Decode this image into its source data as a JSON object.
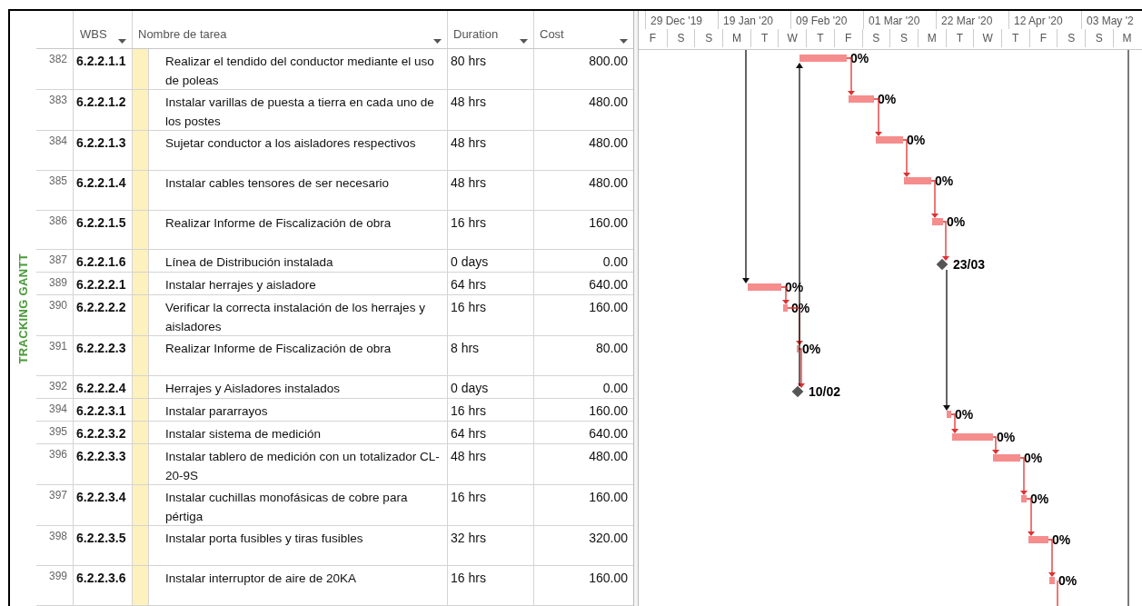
{
  "view_label": "TRACKING GANTT",
  "columns": [
    {
      "label": "WBS"
    },
    {
      "label": "Nombre de tarea"
    },
    {
      "label": "Duration"
    },
    {
      "label": "Cost"
    }
  ],
  "timescale": {
    "major": [
      "29 Dec '19",
      "19 Jan '20",
      "09 Feb '20",
      "01 Mar '20",
      "22 Mar '20",
      "12 Apr '20",
      "03 May '2"
    ],
    "minor": [
      "F",
      "S",
      "S",
      "M",
      "T",
      "W",
      "T",
      "F",
      "S",
      "S",
      "M",
      "T",
      "W",
      "T",
      "F",
      "S",
      "S",
      "M"
    ]
  },
  "rows": [
    {
      "id": "382",
      "wbs": "6.2.2.1.1",
      "name": "Realizar el tendido del conductor mediante el uso de poleas",
      "duration": "80 hrs",
      "cost": "800.00",
      "bar": {
        "kind": "task",
        "label": "0%"
      }
    },
    {
      "id": "383",
      "wbs": "6.2.2.1.2",
      "name": "Instalar varillas de puesta a tierra en cada uno de los postes",
      "duration": "48 hrs",
      "cost": "480.00",
      "bar": {
        "kind": "task",
        "label": "0%"
      }
    },
    {
      "id": "384",
      "wbs": "6.2.2.1.3",
      "name": "Sujetar conductor a los aisladores respectivos",
      "duration": "48 hrs",
      "cost": "480.00",
      "bar": {
        "kind": "task",
        "label": "0%"
      }
    },
    {
      "id": "385",
      "wbs": "6.2.2.1.4",
      "name": "Instalar cables tensores de ser necesario",
      "duration": "48 hrs",
      "cost": "480.00",
      "bar": {
        "kind": "task",
        "label": "0%"
      }
    },
    {
      "id": "386",
      "wbs": "6.2.2.1.5",
      "name": "Realizar Informe de Fiscalización de obra",
      "duration": "16 hrs",
      "cost": "160.00",
      "bar": {
        "kind": "task",
        "label": "0%"
      }
    },
    {
      "id": "387",
      "wbs": "6.2.2.1.6",
      "name": "Línea de Distribución instalada",
      "duration": "0 days",
      "cost": "0.00",
      "bar": {
        "kind": "milestone",
        "label": "23/03"
      }
    },
    {
      "id": "389",
      "wbs": "6.2.2.2.1",
      "name": "Instalar herrajes y aisladore",
      "duration": "64 hrs",
      "cost": "640.00",
      "bar": {
        "kind": "task",
        "label": "0%"
      }
    },
    {
      "id": "390",
      "wbs": "6.2.2.2.2",
      "name": "Verificar la correcta instalación de los herrajes y aisladores",
      "duration": "16 hrs",
      "cost": "160.00",
      "bar": {
        "kind": "task",
        "label": "0%"
      }
    },
    {
      "id": "391",
      "wbs": "6.2.2.2.3",
      "name": "Realizar Informe de Fiscalización de obra",
      "duration": "8 hrs",
      "cost": "80.00",
      "bar": {
        "kind": "task",
        "label": "0%"
      }
    },
    {
      "id": "392",
      "wbs": "6.2.2.2.4",
      "name": "Herrajes y Aisladores instalados",
      "duration": "0 days",
      "cost": "0.00",
      "bar": {
        "kind": "milestone",
        "label": "10/02"
      }
    },
    {
      "id": "394",
      "wbs": "6.2.2.3.1",
      "name": "Instalar pararrayos",
      "duration": "16 hrs",
      "cost": "160.00",
      "bar": {
        "kind": "task",
        "label": "0%"
      }
    },
    {
      "id": "395",
      "wbs": "6.2.2.3.2",
      "name": "Instalar sistema de medición",
      "duration": "64 hrs",
      "cost": "640.00",
      "bar": {
        "kind": "task",
        "label": "0%"
      }
    },
    {
      "id": "396",
      "wbs": "6.2.2.3.3",
      "name": "Instalar tablero de medición con un totalizador CL-20-9S",
      "duration": "48 hrs",
      "cost": "480.00",
      "bar": {
        "kind": "task",
        "label": "0%"
      }
    },
    {
      "id": "397",
      "wbs": "6.2.2.3.4",
      "name": "Instalar cuchillas monofásicas de cobre para pértiga",
      "duration": "16 hrs",
      "cost": "160.00",
      "bar": {
        "kind": "task",
        "label": "0%"
      }
    },
    {
      "id": "398",
      "wbs": "6.2.2.3.5",
      "name": "Instalar porta fusibles y tiras fusibles",
      "duration": "32 hrs",
      "cost": "320.00",
      "bar": {
        "kind": "task",
        "label": "0%"
      }
    },
    {
      "id": "399",
      "wbs": "6.2.2.3.6",
      "name": "Instalar interruptor de aire de 20KA",
      "duration": "16 hrs",
      "cost": "160.00",
      "bar": {
        "kind": "task",
        "label": "0%"
      }
    }
  ]
}
